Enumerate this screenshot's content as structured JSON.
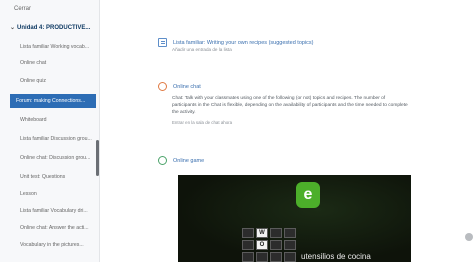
{
  "sidebar": {
    "top_item": "Cerrar",
    "section_title": "Unidad 4: PRODUCTIVE...",
    "items": [
      {
        "label": "Lista familiar Working vocab...",
        "active": false
      },
      {
        "label": "Online chat",
        "active": false
      },
      {
        "label": "Online quiz",
        "active": false
      },
      {
        "label": "Forum: making Connections...",
        "active": true
      },
      {
        "label": "Whiteboard",
        "active": false
      },
      {
        "label": "Lista familiar Discussion grou...",
        "active": false
      },
      {
        "label": "Online chat: Discussion grou...",
        "active": false
      },
      {
        "label": "Unit test: Questions",
        "active": false
      },
      {
        "label": "Lesson",
        "active": false
      },
      {
        "label": "Lista familiar Vocabulary dri...",
        "active": false
      },
      {
        "label": "Online chat: Answer the acti...",
        "active": false
      },
      {
        "label": "Vocabulary in the pictures...",
        "active": false
      }
    ]
  },
  "cards": {
    "first": {
      "title": "Lista familiar: Writing your own recipes (suggested topics)",
      "subtitle": "Añadir una entrada de la lista"
    },
    "second": {
      "title": "Online chat",
      "body": "Chat: Talk with your classmates using one of the following (or not) topics and recipes. The number of participants in the Chat is flexible, depending on the availability of participants and the time needed to complete the activity.",
      "footnote": "Entrar en la sala de chat ahora"
    },
    "third": {
      "title": "Online game"
    }
  },
  "video": {
    "badge_letter": "e",
    "grid_letters": [
      "W",
      "O"
    ],
    "caption": "utensilios de cocina"
  }
}
